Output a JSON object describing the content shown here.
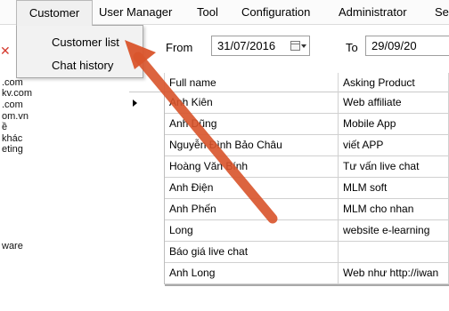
{
  "menu": {
    "items": [
      "Customer",
      "User Manager",
      "Tool",
      "Configuration",
      "Administrator",
      "Se"
    ],
    "dropdown": [
      "Customer list",
      "Chat history"
    ]
  },
  "left_panel": {
    "lines": [
      ".com",
      "kv.com",
      ".com",
      "om.vn",
      "ề",
      "khác",
      "eting",
      "ware"
    ]
  },
  "filter": {
    "from_label": "From",
    "from_value": "31/07/2016",
    "to_label": "To",
    "to_value": "29/09/20"
  },
  "grid": {
    "columns": [
      "Full name",
      "Asking Product"
    ],
    "rows": [
      {
        "name": "Anh Kiên",
        "product": "Web affiliate"
      },
      {
        "name": "Anh Dũng",
        "product": "Mobile App"
      },
      {
        "name": "Nguyễn Đình Bảo Châu",
        "product": "viết APP"
      },
      {
        "name": "Hoàng Văn Bính",
        "product": "Tư vấn live chat"
      },
      {
        "name": "Anh Điện",
        "product": "MLM soft"
      },
      {
        "name": "Anh Phến",
        "product": "MLM cho nhan"
      },
      {
        "name": "Long",
        "product": "website e-learning"
      },
      {
        "name": "Báo giá live chat",
        "product": ""
      },
      {
        "name": "Anh Long",
        "product": "Web như http://iwan"
      }
    ]
  },
  "colors": {
    "annotation_arrow": "#d9542b",
    "close_icon": "#d53b2f"
  }
}
